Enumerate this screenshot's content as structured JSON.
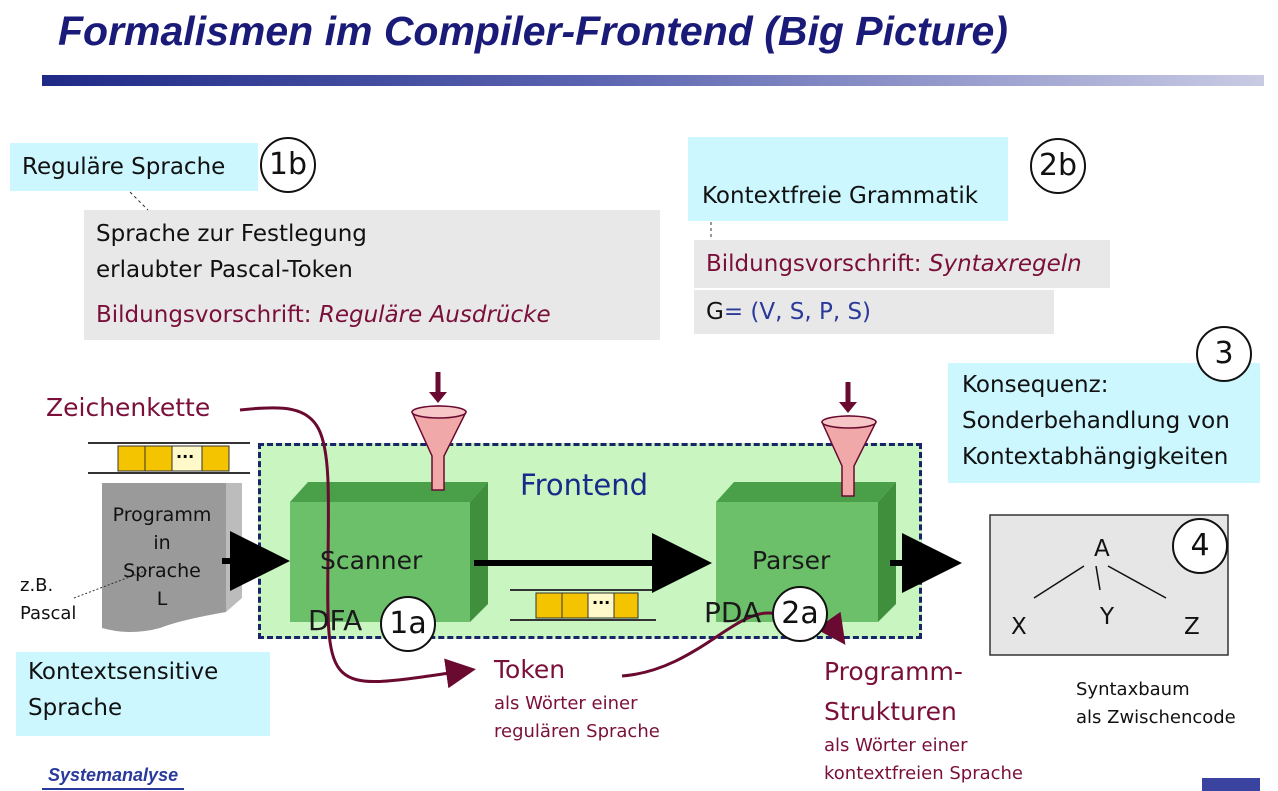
{
  "title": "Formalismen im Compiler-Frontend (Big Picture)",
  "left_top": {
    "label": "Reguläre Sprache",
    "badge": "1b",
    "line1": "Sprache zur Festlegung",
    "line2": "erlaubter Pascal-Token",
    "rule_prefix": "Bildungsvorschrift: ",
    "rule_value": "Reguläre Ausdrücke"
  },
  "right_top": {
    "label": "Kontextfreie Grammatik",
    "badge": "2b",
    "rule_prefix": "Bildungsvorschrift: ",
    "rule_value": "Syntaxregeln",
    "grammar_g": "G",
    "grammar_rest": "= (V, S, P, S)"
  },
  "consequence": {
    "badge": "3",
    "line1": "Konsequenz:",
    "line2": "Sonderbehandlung von",
    "line3": "Kontextabhängigkeiten"
  },
  "input": {
    "chars_label": "Zeichenkette",
    "document_lines": [
      "Programm",
      "in",
      "Sprache",
      "L"
    ],
    "example_line1": "z.B.",
    "example_line2": "Pascal",
    "ellipsis": "..."
  },
  "frontend": {
    "label": "Frontend",
    "scanner": "Scanner",
    "parser": "Parser",
    "dfa": "DFA",
    "dfa_badge": "1a",
    "pda": "PDA",
    "pda_badge": "2a"
  },
  "token": {
    "label": "Token",
    "desc1": "als Wörter einer",
    "desc2": "regulären Sprache"
  },
  "structures": {
    "label1": "Programm-",
    "label2": "Strukturen",
    "desc1": "als Wörter einer",
    "desc2": "kontextfreien Sprache"
  },
  "tree": {
    "badge": "4",
    "root": "A",
    "children": [
      "X",
      "Y",
      "Z"
    ],
    "caption1": "Syntaxbaum",
    "caption2": "als Zwischencode"
  },
  "context_sensitive": {
    "line1": "Kontextsensitive",
    "line2": "Sprache"
  },
  "footer_logo": "Systemanalyse",
  "colors": {
    "title": "#1a1a78",
    "highlight_cyan": "#ccf7ff",
    "note_grey": "#e8e8e8",
    "frontend_green": "#c8f5c0",
    "box_green": "#6cc06a",
    "accent_red": "#7a0f3a",
    "tape_yellow": "#f5c400"
  }
}
